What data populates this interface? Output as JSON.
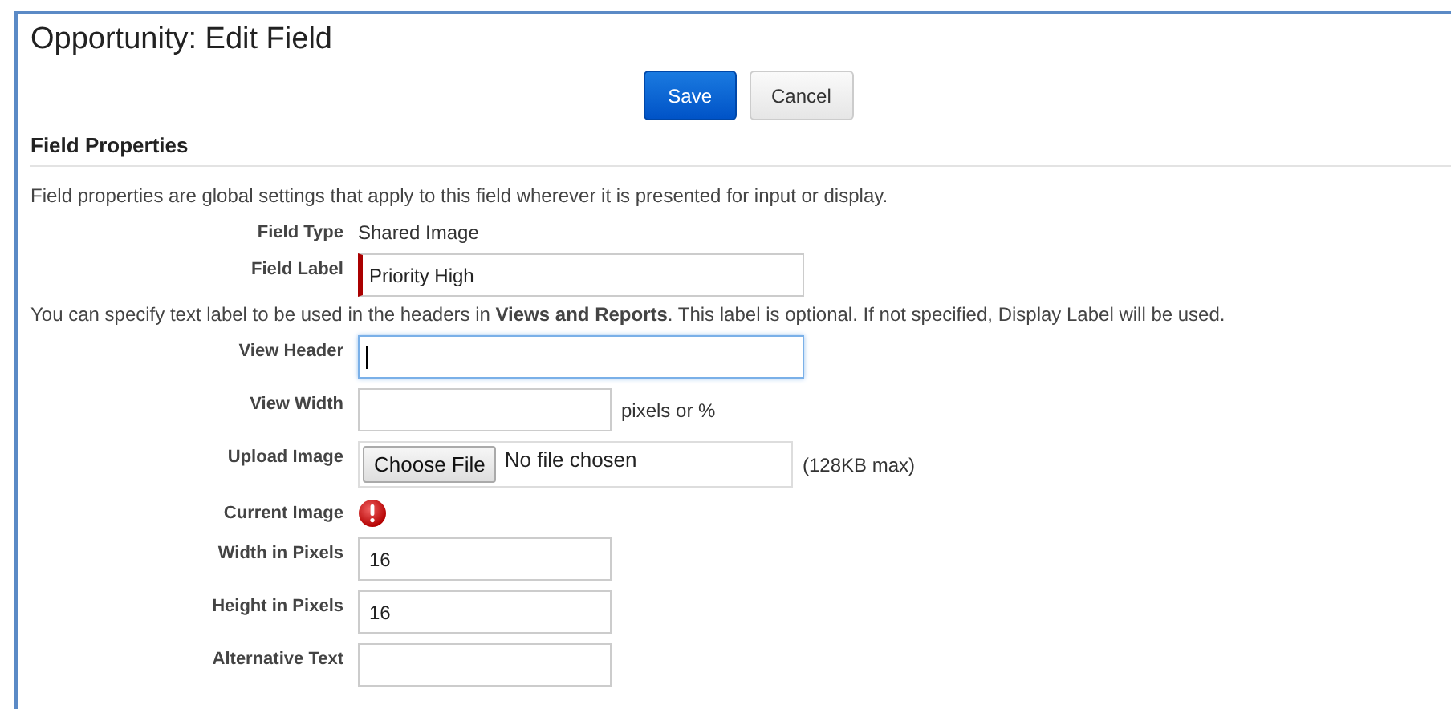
{
  "page": {
    "title": "Opportunity: Edit Field"
  },
  "buttons": [
    {
      "label": "Save",
      "kind": "primary"
    },
    {
      "label": "Cancel",
      "kind": "secondary"
    }
  ],
  "section": {
    "title": "Field Properties",
    "description": "Field properties are global settings that apply to this field wherever it is presented for input or display."
  },
  "fields": [
    {
      "kind": "text",
      "label": "Field Type",
      "value": "Shared Image"
    },
    {
      "kind": "wide-input",
      "label": "Field Label",
      "value": "Priority High",
      "required": true,
      "focused": false
    },
    {
      "kind": "note",
      "text": "You can specify text label to be used in the headers in **Views and Reports**. This label is optional. If not specified, Display Label will be used."
    },
    {
      "kind": "wide-input",
      "label": "View Header",
      "required": false,
      "focused": true
    },
    {
      "kind": "input",
      "label": "View Width",
      "suffix": "pixels or %",
      "required": false,
      "focused": false
    },
    {
      "kind": "file",
      "label": "Upload Image",
      "button": "Choose File",
      "status": "No file chosen",
      "suffix": "(128KB max)"
    },
    {
      "kind": "image",
      "label": "Current Image"
    },
    {
      "kind": "input",
      "label": "Width in Pixels",
      "value": "16",
      "required": false,
      "focused": false
    },
    {
      "kind": "input",
      "label": "Height in Pixels",
      "value": "16",
      "required": false,
      "focused": false
    },
    {
      "kind": "input",
      "label": "Alternative Text",
      "required": false,
      "focused": false
    }
  ]
}
